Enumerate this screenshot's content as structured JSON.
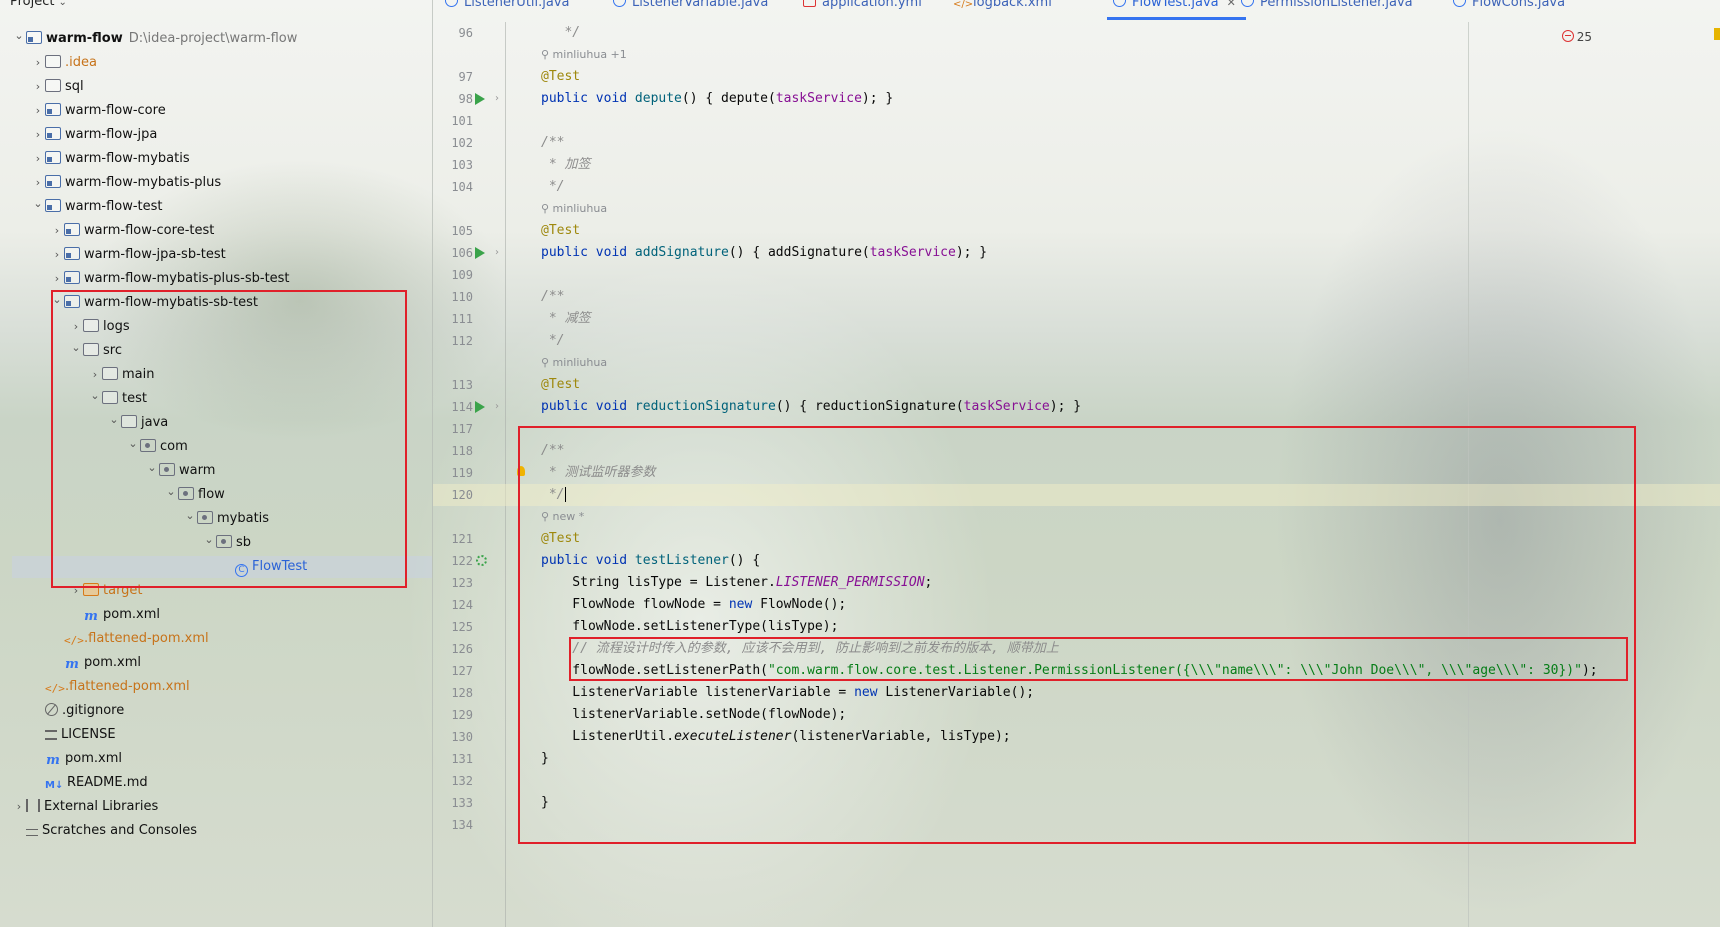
{
  "project_panel": {
    "title": "Project",
    "tree": [
      {
        "label": "warm-flow",
        "path": "D:\\idea-project\\warm-flow",
        "icon": "module-icon",
        "indent": 0,
        "arrow": "expanded",
        "bold": true,
        "color": ""
      },
      {
        "label": ".idea",
        "icon": "folder-icon",
        "indent": 1,
        "arrow": "collapsed",
        "color": "orange"
      },
      {
        "label": "sql",
        "icon": "folder-icon",
        "indent": 1,
        "arrow": "collapsed"
      },
      {
        "label": "warm-flow-core",
        "icon": "module-icon",
        "indent": 1,
        "arrow": "collapsed"
      },
      {
        "label": "warm-flow-jpa",
        "icon": "module-icon",
        "indent": 1,
        "arrow": "collapsed"
      },
      {
        "label": "warm-flow-mybatis",
        "icon": "module-icon",
        "indent": 1,
        "arrow": "collapsed"
      },
      {
        "label": "warm-flow-mybatis-plus",
        "icon": "module-icon",
        "indent": 1,
        "arrow": "collapsed"
      },
      {
        "label": "warm-flow-test",
        "icon": "module-icon",
        "indent": 1,
        "arrow": "expanded"
      },
      {
        "label": "warm-flow-core-test",
        "icon": "module-icon",
        "indent": 2,
        "arrow": "collapsed"
      },
      {
        "label": "warm-flow-jpa-sb-test",
        "icon": "module-icon",
        "indent": 2,
        "arrow": "collapsed"
      },
      {
        "label": "warm-flow-mybatis-plus-sb-test",
        "icon": "module-icon",
        "indent": 2,
        "arrow": "collapsed"
      },
      {
        "label": "warm-flow-mybatis-sb-test",
        "icon": "module-icon",
        "indent": 2,
        "arrow": "expanded"
      },
      {
        "label": "logs",
        "icon": "folder-icon",
        "indent": 3,
        "arrow": "collapsed"
      },
      {
        "label": "src",
        "icon": "folder-icon",
        "indent": 3,
        "arrow": "expanded"
      },
      {
        "label": "main",
        "icon": "folder-icon",
        "indent": 4,
        "arrow": "collapsed"
      },
      {
        "label": "test",
        "icon": "folder-icon",
        "indent": 4,
        "arrow": "expanded"
      },
      {
        "label": "java",
        "icon": "folder-icon",
        "indent": 5,
        "arrow": "expanded"
      },
      {
        "label": "com",
        "icon": "package-icon",
        "indent": 6,
        "arrow": "expanded"
      },
      {
        "label": "warm",
        "icon": "package-icon",
        "indent": 7,
        "arrow": "expanded"
      },
      {
        "label": "flow",
        "icon": "package-icon",
        "indent": 8,
        "arrow": "expanded"
      },
      {
        "label": "mybatis",
        "icon": "package-icon",
        "indent": 9,
        "arrow": "expanded"
      },
      {
        "label": "sb",
        "icon": "package-icon",
        "indent": 10,
        "arrow": "expanded"
      },
      {
        "label": "FlowTest",
        "icon": "class-icon",
        "indent": 11,
        "arrow": "none",
        "selected": true,
        "color": "blue"
      },
      {
        "label": "target",
        "icon": "target-icon",
        "indent": 3,
        "arrow": "collapsed",
        "color": "orange"
      },
      {
        "label": "pom.xml",
        "icon": "maven-icon",
        "indent": 3,
        "arrow": "none"
      },
      {
        "label": ".flattened-pom.xml",
        "icon": "xml-icon",
        "indent": 2,
        "arrow": "none",
        "color": "orange"
      },
      {
        "label": "pom.xml",
        "icon": "maven-icon",
        "indent": 2,
        "arrow": "none"
      },
      {
        "label": ".flattened-pom.xml",
        "icon": "xml-icon",
        "indent": 1,
        "arrow": "none",
        "color": "orange"
      },
      {
        "label": ".gitignore",
        "icon": "ignore-icon",
        "indent": 1,
        "arrow": "none"
      },
      {
        "label": "LICENSE",
        "icon": "license-icon",
        "indent": 1,
        "arrow": "none"
      },
      {
        "label": "pom.xml",
        "icon": "maven-icon",
        "indent": 1,
        "arrow": "none"
      },
      {
        "label": "README.md",
        "icon": "md-icon",
        "indent": 1,
        "arrow": "none"
      },
      {
        "label": "External Libraries",
        "icon": "lib-icon",
        "indent": 0,
        "arrow": "collapsed"
      },
      {
        "label": "Scratches and Consoles",
        "icon": "scratch-icon",
        "indent": 0,
        "arrow": "none"
      }
    ]
  },
  "tabs": [
    {
      "label": "ListenerUtil.java",
      "icon": "class"
    },
    {
      "label": "ListenerVariable.java",
      "icon": "class"
    },
    {
      "label": "application.yml",
      "icon": "yml"
    },
    {
      "label": "logback.xml",
      "icon": "xml"
    },
    {
      "label": "FlowTest.java",
      "icon": "class",
      "active": true
    },
    {
      "label": "PermissionListener.java",
      "icon": "class"
    },
    {
      "label": "FlowCons.java",
      "icon": "class"
    }
  ],
  "editor": {
    "error_count": "25",
    "lines": [
      {
        "n": "96",
        "tokens": [
          [
            "cmt",
            "   */"
          ]
        ]
      },
      {
        "hint": "minliuhua +1"
      },
      {
        "n": "97",
        "tokens": [
          [
            "ann",
            "@Test"
          ]
        ]
      },
      {
        "n": "98",
        "run": true,
        "tokens": [
          [
            "kw",
            "public void "
          ],
          [
            "fn",
            "depute"
          ],
          [
            "",
            "() { depute("
          ],
          [
            "fld",
            "taskService"
          ],
          [
            "",
            "); }"
          ]
        ]
      },
      {
        "n": "101",
        "tokens": []
      },
      {
        "n": "102",
        "tokens": [
          [
            "cmt",
            "/**"
          ]
        ]
      },
      {
        "n": "103",
        "tokens": [
          [
            "cmt",
            " * 加签"
          ]
        ]
      },
      {
        "n": "104",
        "tokens": [
          [
            "cmt",
            " */"
          ]
        ]
      },
      {
        "hint": "minliuhua"
      },
      {
        "n": "105",
        "tokens": [
          [
            "ann",
            "@Test"
          ]
        ]
      },
      {
        "n": "106",
        "run": true,
        "tokens": [
          [
            "kw",
            "public void "
          ],
          [
            "fn",
            "addSignature"
          ],
          [
            "",
            "() { addSignature("
          ],
          [
            "fld",
            "taskService"
          ],
          [
            "",
            "); }"
          ]
        ]
      },
      {
        "n": "109",
        "tokens": []
      },
      {
        "n": "110",
        "tokens": [
          [
            "cmt",
            "/**"
          ]
        ]
      },
      {
        "n": "111",
        "tokens": [
          [
            "cmt",
            " * 减签"
          ]
        ]
      },
      {
        "n": "112",
        "tokens": [
          [
            "cmt",
            " */"
          ]
        ]
      },
      {
        "hint": "minliuhua"
      },
      {
        "n": "113",
        "tokens": [
          [
            "ann",
            "@Test"
          ]
        ]
      },
      {
        "n": "114",
        "run": true,
        "tokens": [
          [
            "kw",
            "public void "
          ],
          [
            "fn",
            "reductionSignature"
          ],
          [
            "",
            "() { reductionSignature("
          ],
          [
            "fld",
            "taskService"
          ],
          [
            "",
            "); }"
          ]
        ]
      },
      {
        "n": "117",
        "tokens": []
      },
      {
        "n": "118",
        "tokens": [
          [
            "cmt",
            "/**"
          ]
        ]
      },
      {
        "n": "119",
        "bulb": true,
        "tokens": [
          [
            "cmt",
            " * 测试监听器参数"
          ]
        ]
      },
      {
        "n": "120",
        "caret": true,
        "tokens": [
          [
            "cmt",
            " */"
          ]
        ]
      },
      {
        "hint": "new *"
      },
      {
        "n": "121",
        "tokens": [
          [
            "ann",
            "@Test"
          ]
        ]
      },
      {
        "n": "122",
        "gear": true,
        "tokens": [
          [
            "kw",
            "public void "
          ],
          [
            "fn",
            "testListener"
          ],
          [
            "",
            "() {"
          ]
        ]
      },
      {
        "n": "123",
        "tokens": [
          [
            "",
            "    String lisType = Listener."
          ],
          [
            "const",
            "LISTENER_PERMISSION"
          ],
          [
            "",
            ";"
          ]
        ]
      },
      {
        "n": "124",
        "tokens": [
          [
            "",
            "    FlowNode flowNode = "
          ],
          [
            "kw",
            "new "
          ],
          [
            "",
            "FlowNode();"
          ]
        ]
      },
      {
        "n": "125",
        "tokens": [
          [
            "",
            "    flowNode.setListenerType(lisType);"
          ]
        ]
      },
      {
        "n": "126",
        "tokens": [
          [
            "cmt",
            "    // 流程设计时传入的参数, 应该不会用到, 防止影响到之前发布的版本, 顺带加上"
          ]
        ]
      },
      {
        "n": "127",
        "tokens": [
          [
            "",
            "    flowNode.setListenerPath("
          ],
          [
            "str",
            "\"com.warm.flow.core.test.Listener.PermissionListener({\\\\\\\"name\\\\\\\": \\\\\\\"John Doe\\\\\\\", \\\\\\\"age\\\\\\\": 30})\""
          ],
          [
            "",
            ");"
          ]
        ]
      },
      {
        "n": "128",
        "tokens": [
          [
            "",
            "    ListenerVariable listenerVariable = "
          ],
          [
            "kw",
            "new "
          ],
          [
            "",
            "ListenerVariable();"
          ]
        ]
      },
      {
        "n": "129",
        "tokens": [
          [
            "",
            "    listenerVariable.setNode(flowNode);"
          ]
        ]
      },
      {
        "n": "130",
        "tokens": [
          [
            "",
            "    ListenerUtil."
          ],
          [
            "ifn",
            "executeListener"
          ],
          [
            "",
            "(listenerVariable, lisType);"
          ]
        ]
      },
      {
        "n": "131",
        "tokens": [
          [
            "",
            "}"
          ]
        ]
      },
      {
        "n": "132",
        "tokens": []
      },
      {
        "n": "133",
        "tokens": [
          [
            "",
            "}"
          ]
        ]
      },
      {
        "n": "134",
        "tokens": []
      }
    ]
  }
}
